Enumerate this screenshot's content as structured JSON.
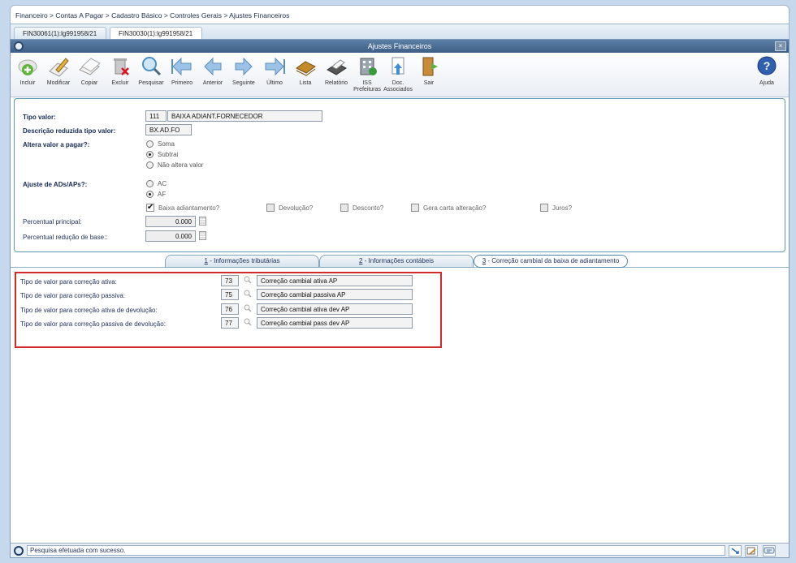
{
  "breadcrumb": "Financeiro > Contas A Pagar > Cadastro Básico > Controles Gerais > Ajustes Financeiros",
  "doc_tabs": [
    "FIN30061(1):lg991958/21",
    "FIN30030(1):lg991958/21"
  ],
  "window": {
    "title": "Ajustes Financeiros",
    "close": "×"
  },
  "toolbar": {
    "buttons": [
      {
        "label": "Incluir",
        "icon": "add-icon"
      },
      {
        "label": "Modificar",
        "icon": "edit-icon"
      },
      {
        "label": "Copiar",
        "icon": "copy-icon"
      },
      {
        "label": "Excluir",
        "icon": "delete-icon"
      },
      {
        "label": "Pesquisar",
        "icon": "search-icon"
      },
      {
        "label": "Primeiro",
        "icon": "first-icon"
      },
      {
        "label": "Anterior",
        "icon": "previous-icon"
      },
      {
        "label": "Seguinte",
        "icon": "next-icon"
      },
      {
        "label": "Último",
        "icon": "last-icon"
      },
      {
        "label": "Lista",
        "icon": "list-icon"
      },
      {
        "label": "Relatório",
        "icon": "report-icon"
      },
      {
        "label": "ISS Prefeituras",
        "icon": "iss-icon"
      },
      {
        "label": "Doc. Associados",
        "icon": "documents-icon"
      },
      {
        "label": "Sair",
        "icon": "exit-icon"
      }
    ],
    "help": {
      "label": "Ajuda",
      "icon": "help-icon"
    }
  },
  "form": {
    "tipo_valor": {
      "label": "Tipo valor:",
      "code": "111",
      "desc": "BAIXA ADIANT.FORNECEDOR"
    },
    "descricao": {
      "label": "Descrição reduzida tipo valor:",
      "value": "BX.AD.FO"
    },
    "altera": {
      "label": "Altera valor a pagar?:",
      "options": [
        "Soma",
        "Subtrai",
        "Não altera valor"
      ],
      "selected": "Subtrai"
    },
    "ajuste": {
      "label": "Ajuste de ADs/APs?:",
      "options": [
        "AC",
        "AF"
      ],
      "selected": "AF"
    },
    "checks": [
      {
        "label": "Baixa adiantamento?",
        "checked": true
      },
      {
        "label": "Devolução?",
        "checked": false
      },
      {
        "label": "Desconto?",
        "checked": false
      },
      {
        "label": "Gera carta alteração?",
        "checked": false
      },
      {
        "label": "Juros?",
        "checked": false
      }
    ],
    "percentual_principal": {
      "label": "Percentual principal:",
      "value": "0.000"
    },
    "percentual_reducao": {
      "label": "Percentual redução de base::",
      "value": "0.000"
    }
  },
  "tabs": [
    {
      "num": "1",
      "label": " - Informações tributárias"
    },
    {
      "num": "2",
      "label": " - Informações contábeis"
    },
    {
      "num": "3",
      "label": " - Correção cambial da baixa de adiantamento"
    }
  ],
  "correction": [
    {
      "label": "Tipo de valor para correção ativa:",
      "code": "73",
      "desc": "Correção cambial ativa AP"
    },
    {
      "label": "Tipo de valor para correção passiva:",
      "code": "75",
      "desc": "Correção cambial passiva AP"
    },
    {
      "label": "Tipo de valor para correção ativa de devolução:",
      "code": "76",
      "desc": "Correção cambial ativa dev AP"
    },
    {
      "label": "Tipo de valor para correção passiva de devolução:",
      "code": "77",
      "desc": "Correção cambial pass dev AP"
    }
  ],
  "status": "Pesquisa efetuada com sucesso."
}
